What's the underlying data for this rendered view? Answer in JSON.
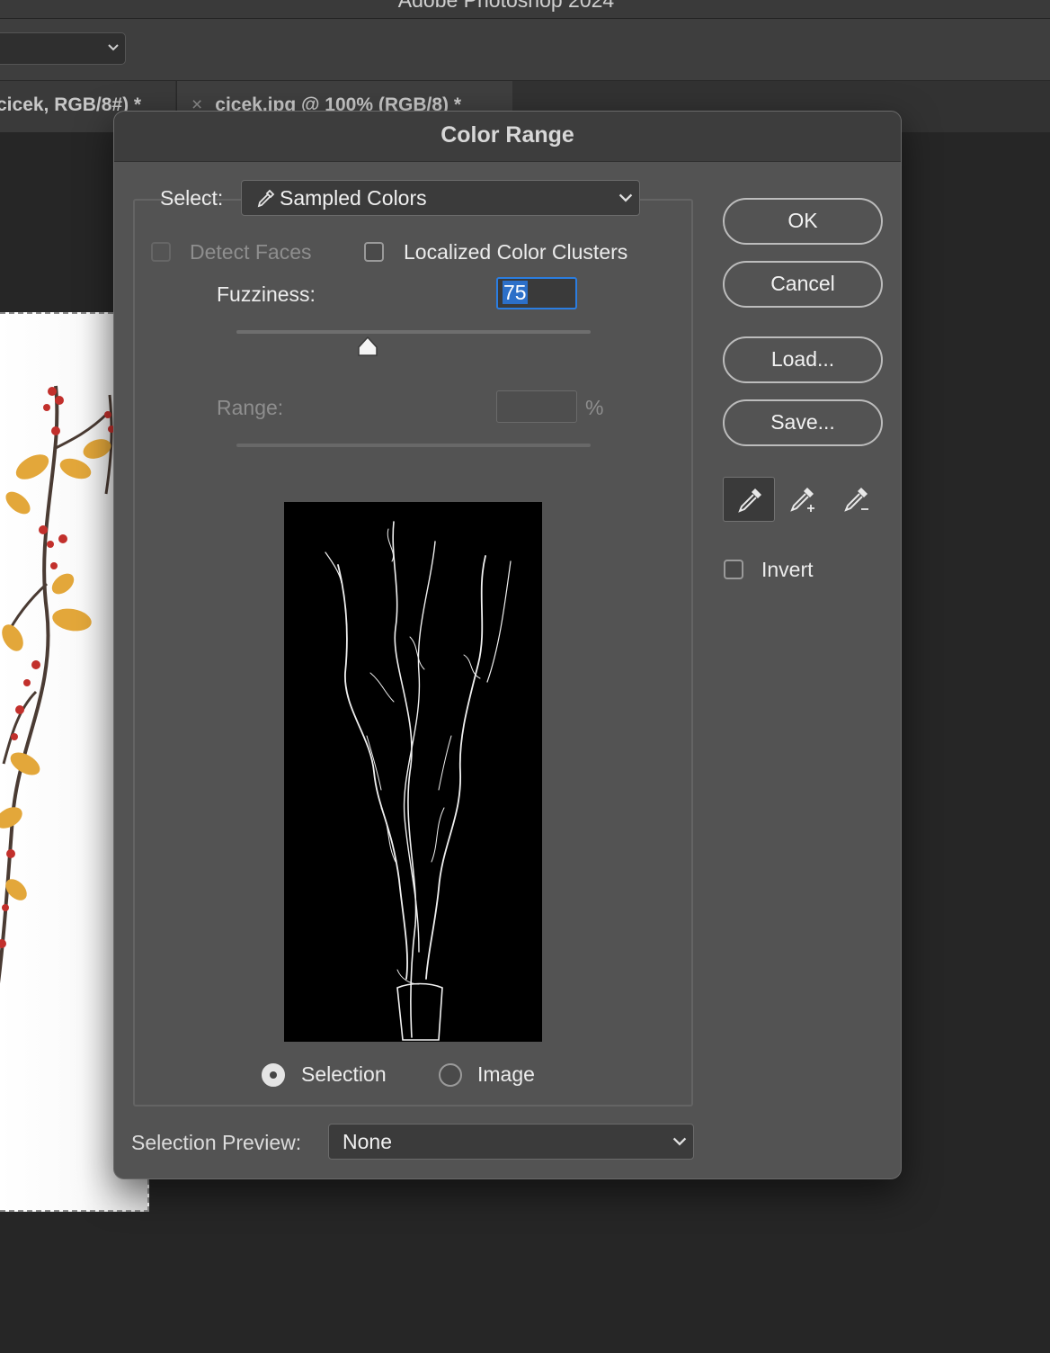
{
  "app": {
    "window_title": "Adobe Photoshop 2024"
  },
  "tabs": [
    {
      "label": "cicek, RGB/8#) *"
    },
    {
      "close_glyph": "×",
      "label": "cicek.jpg @ 100% (RGB/8) *"
    }
  ],
  "dialog": {
    "title": "Color Range",
    "select_label": "Select:",
    "select_value": "Sampled Colors",
    "select_icon": "eyedropper-icon",
    "detect_faces_label": "Detect Faces",
    "detect_faces_checked": false,
    "detect_faces_enabled": false,
    "localized_clusters_label": "Localized Color Clusters",
    "localized_clusters_checked": false,
    "fuzziness_label": "Fuzziness:",
    "fuzziness_value": "75",
    "fuzziness_slider_fraction": 0.37,
    "range_label": "Range:",
    "range_value": "",
    "range_unit": "%",
    "view_options": [
      {
        "label": "Selection",
        "selected": true
      },
      {
        "label": "Image",
        "selected": false
      }
    ],
    "selection_preview_label": "Selection Preview:",
    "selection_preview_value": "None",
    "buttons": {
      "ok": "OK",
      "cancel": "Cancel",
      "load": "Load...",
      "save": "Save..."
    },
    "eyedroppers": [
      {
        "icon": "eyedropper-icon",
        "active": true
      },
      {
        "icon": "eyedropper-plus-icon",
        "active": false
      },
      {
        "icon": "eyedropper-minus-icon",
        "active": false
      }
    ],
    "invert_label": "Invert",
    "invert_checked": false
  },
  "colors": {
    "dialog_bg": "#535353",
    "focus_ring": "#2b7de0",
    "text_selection": "#2c6fc8"
  }
}
